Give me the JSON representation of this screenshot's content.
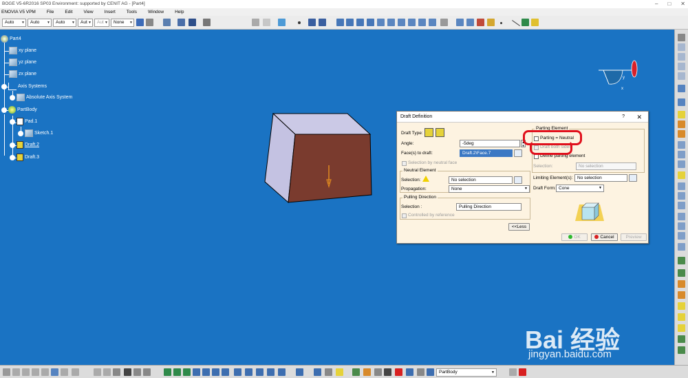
{
  "window": {
    "title": "BOGE V5-6R2016 SP03 Environment: supported by CENIT AG - [Part4]",
    "min": "–",
    "max": "□",
    "close": "✕"
  },
  "menu": [
    "ENOVIA V5 VPM",
    "File",
    "Edit",
    "View",
    "Insert",
    "Tools",
    "Window",
    "Help"
  ],
  "toolbar": {
    "combos": [
      "Auto",
      "Auto",
      "Auto",
      "Aut",
      "Aut",
      "None"
    ]
  },
  "tree": {
    "root": "Part4",
    "xy": "xy plane",
    "yz": "yz plane",
    "zx": "zx plane",
    "axis_systems": "Axis Systems",
    "absolute_axis": "Absolute Axis System",
    "partbody": "PartBody",
    "pad": "Pad.1",
    "sketch": "Sketch.1",
    "draft2": "Draft.2",
    "draft3": "Draft.3"
  },
  "dialog": {
    "title": "Draft Definition",
    "help": "?",
    "close": "✕",
    "draft_type_label": "Draft Type:",
    "angle_label": "Angle:",
    "angle_value": "-5deg",
    "faces_label": "Face(s) to draft:",
    "faces_value": "Draft.2\\Face.7",
    "sel_by_neutral": "Selection by neutral face",
    "neutral_element": "Neutral Element",
    "selection_label": "Selection:",
    "neutral_selection": "No selection",
    "propagation_label": "Propagation:",
    "propagation_value": "None",
    "pulling_direction": "Pulling Direction",
    "pulling_selection_label": "Selection :",
    "pulling_selection_value": "Pulling Direction",
    "controlled_by_ref": "Controlled by reference",
    "less_button": "<<Less",
    "parting_element": "Parting Element",
    "parting_neutral": "Parting = Neutral",
    "draft_both_sides": "Draft both sides",
    "define_parting": "Define parting element",
    "parting_selection_label": "Selection:",
    "parting_selection_value": "No selection",
    "limiting_label": "Limiting Element(s):",
    "limiting_value": "No selection",
    "draft_form_label": "Draft Form:",
    "draft_form_value": "Cone",
    "ok": "OK",
    "cancel": "Cancel",
    "preview": "Preview"
  },
  "statusbar": {
    "body_combo": "PartBody"
  },
  "compass": {
    "x": "x",
    "y": "y"
  },
  "watermark": {
    "text": "Bai 经验",
    "url": "jingyan.baidu.com"
  },
  "colors": {
    "background": "#1a73c3",
    "highlight": "#e0101c",
    "face_selected": "#7a3b2e"
  }
}
